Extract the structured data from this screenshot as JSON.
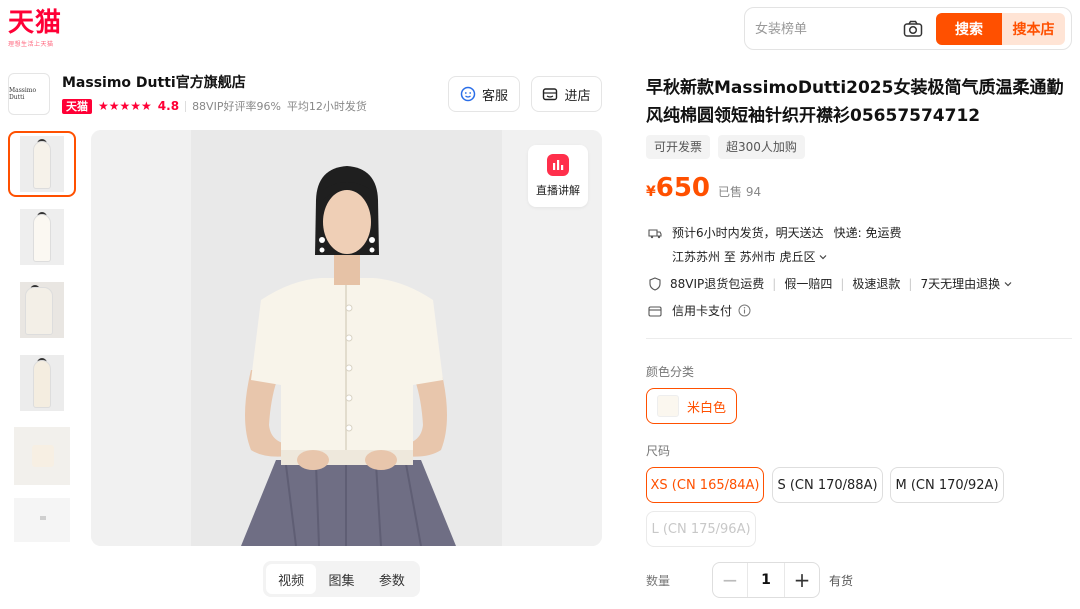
{
  "header": {
    "logo_text": "天猫",
    "logo_sub": "理想生活上天猫",
    "search_placeholder": "女装榜单",
    "search_btn": "搜索",
    "store_search_btn": "搜本店"
  },
  "store": {
    "logo_text": "Massimo Dutti",
    "name": "Massimo Dutti官方旗舰店",
    "badge": "天猫",
    "stars": "★★★★★",
    "rating": "4.8",
    "vip_rate": "88VIP好评率96%",
    "ship_time": "平均12小时发货",
    "service_btn": "客服",
    "enter_btn": "进店"
  },
  "gallery": {
    "live_label": "直播讲解",
    "tabs": [
      "视频",
      "图集",
      "参数"
    ],
    "active_tab": 0
  },
  "product": {
    "title": "早秋新款MassimoDutti2025女装极简气质温柔通勤风纯棉圆领短袖针织开襟衫05657574712",
    "tags": [
      "可开发票",
      "超300人加购"
    ],
    "price_currency": "¥",
    "price": "650",
    "sold": "已售 94"
  },
  "shipping": {
    "estimate": "预计6小时内发货，明天送达",
    "express": "快递: 免运费",
    "route": "江苏苏州 至 苏州市 虎丘区",
    "guarantees": [
      "88VIP退货包运费",
      "假一赔四",
      "极速退款",
      "7天无理由退换"
    ],
    "payment": "信用卡支付"
  },
  "options": {
    "color_label": "颜色分类",
    "color_value": "米白色",
    "size_label": "尺码",
    "sizes": [
      "XS (CN 165/84A)",
      "S (CN 170/88A)",
      "M (CN 170/92A)",
      "L (CN 175/96A)"
    ],
    "qty_label": "数量",
    "qty": "1",
    "stock": "有货"
  },
  "colors": {
    "accent": "#ff5000",
    "tmall_red": "#ff0036"
  }
}
